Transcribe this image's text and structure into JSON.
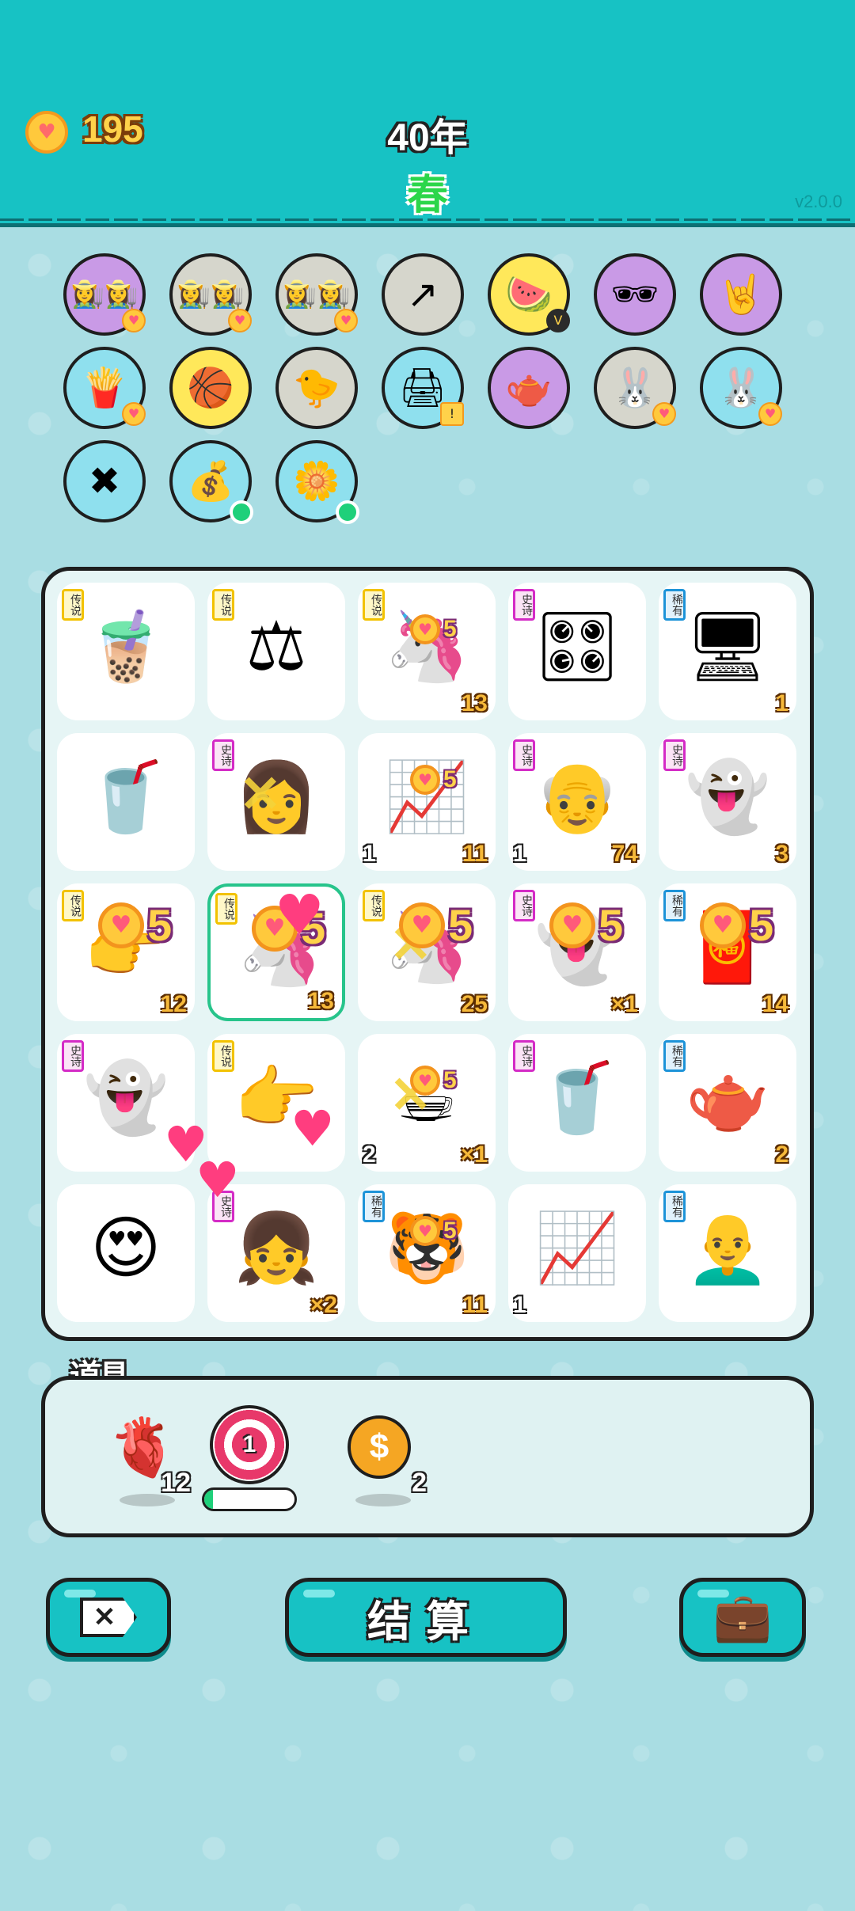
{
  "header": {
    "coins": "195",
    "year": "40年",
    "season": "春",
    "version": "v2.0.0"
  },
  "badges": [
    {
      "icon": "👩‍🌾👩‍🌾",
      "bg": "#c99ae6",
      "mark": "heart"
    },
    {
      "icon": "👩‍🌾👩‍🌾",
      "bg": "#d6d6cc",
      "mark": "heart"
    },
    {
      "icon": "👩‍🌾👩‍🌾",
      "bg": "#d6d6cc",
      "mark": "heart"
    },
    {
      "icon": "↗",
      "bg": "#d6d6cc",
      "mark": ""
    },
    {
      "icon": "🍉",
      "bg": "#ffe85a",
      "mark": "v"
    },
    {
      "icon": "🕶",
      "bg": "#c99ae6",
      "mark": ""
    },
    {
      "icon": "🤘",
      "bg": "#c99ae6",
      "mark": ""
    },
    {
      "icon": "🍟",
      "bg": "#8fe0ee",
      "mark": "heart"
    },
    {
      "icon": "🏀",
      "bg": "#ffe85a",
      "mark": ""
    },
    {
      "icon": "🐤",
      "bg": "#d6d6cc",
      "mark": ""
    },
    {
      "icon": "🖨",
      "bg": "#8fe0ee",
      "mark": "warn"
    },
    {
      "icon": "🫖",
      "bg": "#c99ae6",
      "mark": ""
    },
    {
      "icon": "🐰",
      "bg": "#d6d6cc",
      "mark": "heart"
    },
    {
      "icon": "🐰",
      "bg": "#8fe0ee",
      "mark": "heart"
    },
    {
      "icon": "✖",
      "bg": "#8fe0ee",
      "mark": ""
    },
    {
      "icon": "💰",
      "bg": "#8fe0ee",
      "mark": "dot"
    },
    {
      "icon": "🌼",
      "bg": "#8fe0ee",
      "mark": "dot"
    }
  ],
  "board": {
    "cells": [
      {
        "rarity": "传说",
        "r": "legend",
        "icon": "🧋",
        "num": "",
        "left": ""
      },
      {
        "rarity": "传说",
        "r": "legend",
        "icon": "⚖",
        "num": "",
        "left": ""
      },
      {
        "rarity": "传说",
        "r": "legend",
        "icon": "🦄",
        "num": "13",
        "left": "",
        "bonus": "5",
        "bsize": "small"
      },
      {
        "rarity": "史诗",
        "r": "epic",
        "icon": "🎛",
        "num": "",
        "left": ""
      },
      {
        "rarity": "稀有",
        "r": "rare",
        "icon": "🖥",
        "num": "1",
        "left": ""
      },
      {
        "rarity": "",
        "r": "",
        "icon": "🥤",
        "num": "",
        "left": ""
      },
      {
        "rarity": "史诗",
        "r": "epic",
        "icon": "👩",
        "num": "",
        "left": "",
        "cross": "✕"
      },
      {
        "rarity": "",
        "r": "",
        "icon": "📈",
        "num": "11",
        "left": "1",
        "bonus": "5",
        "bsize": "small"
      },
      {
        "rarity": "史诗",
        "r": "epic",
        "icon": "👴",
        "num": "74",
        "left": "1"
      },
      {
        "rarity": "史诗",
        "r": "epic",
        "icon": "👻",
        "num": "3",
        "left": ""
      },
      {
        "rarity": "传说",
        "r": "legend",
        "icon": "👉",
        "num": "12",
        "left": "",
        "bonus": "5",
        "bsize": "big"
      },
      {
        "rarity": "传说",
        "r": "legend",
        "icon": "🦄",
        "num": "13",
        "left": "",
        "bonus": "5",
        "bsize": "big",
        "selected": true
      },
      {
        "rarity": "传说",
        "r": "legend",
        "icon": "🦄",
        "num": "25",
        "left": "",
        "bonus": "5",
        "bsize": "big",
        "cross": "✕"
      },
      {
        "rarity": "史诗",
        "r": "epic",
        "icon": "👻",
        "num": "×1",
        "left": "",
        "bonus": "5",
        "bsize": "big"
      },
      {
        "rarity": "稀有",
        "r": "rare",
        "icon": "🧧",
        "num": "14",
        "left": "",
        "bonus": "5",
        "bsize": "big"
      },
      {
        "rarity": "史诗",
        "r": "epic",
        "icon": "👻",
        "num": "",
        "left": ""
      },
      {
        "rarity": "传说",
        "r": "legend",
        "icon": "👉",
        "num": "",
        "left": ""
      },
      {
        "rarity": "",
        "r": "",
        "icon": "☕",
        "num": "×1",
        "left": "2",
        "bonus": "5",
        "bsize": "small",
        "cross": "✕"
      },
      {
        "rarity": "史诗",
        "r": "epic",
        "icon": "🥤",
        "num": "",
        "left": ""
      },
      {
        "rarity": "稀有",
        "r": "rare",
        "icon": "🫖",
        "num": "2",
        "left": ""
      },
      {
        "rarity": "",
        "r": "",
        "icon": "😍",
        "num": "",
        "left": ""
      },
      {
        "rarity": "史诗",
        "r": "epic",
        "icon": "👧",
        "num": "×2",
        "left": ""
      },
      {
        "rarity": "稀有",
        "r": "rare",
        "icon": "🐯",
        "num": "11",
        "left": "",
        "bonus": "5",
        "bsize": "small"
      },
      {
        "rarity": "",
        "r": "",
        "icon": "📈",
        "num": "",
        "left": "1"
      },
      {
        "rarity": "稀有",
        "r": "rare",
        "icon": "👨‍🦲",
        "num": "",
        "left": ""
      }
    ]
  },
  "tools": {
    "title": "道具",
    "items": [
      {
        "name": "liver",
        "icon": "🫀",
        "count": "12"
      },
      {
        "name": "target",
        "icon": "1",
        "count": "",
        "progress": 0.1
      },
      {
        "name": "coin",
        "icon": "💲",
        "count": "2"
      }
    ]
  },
  "buttons": {
    "close_symbol": "✕",
    "settle_label": "结算",
    "bag_icon": "💼"
  }
}
